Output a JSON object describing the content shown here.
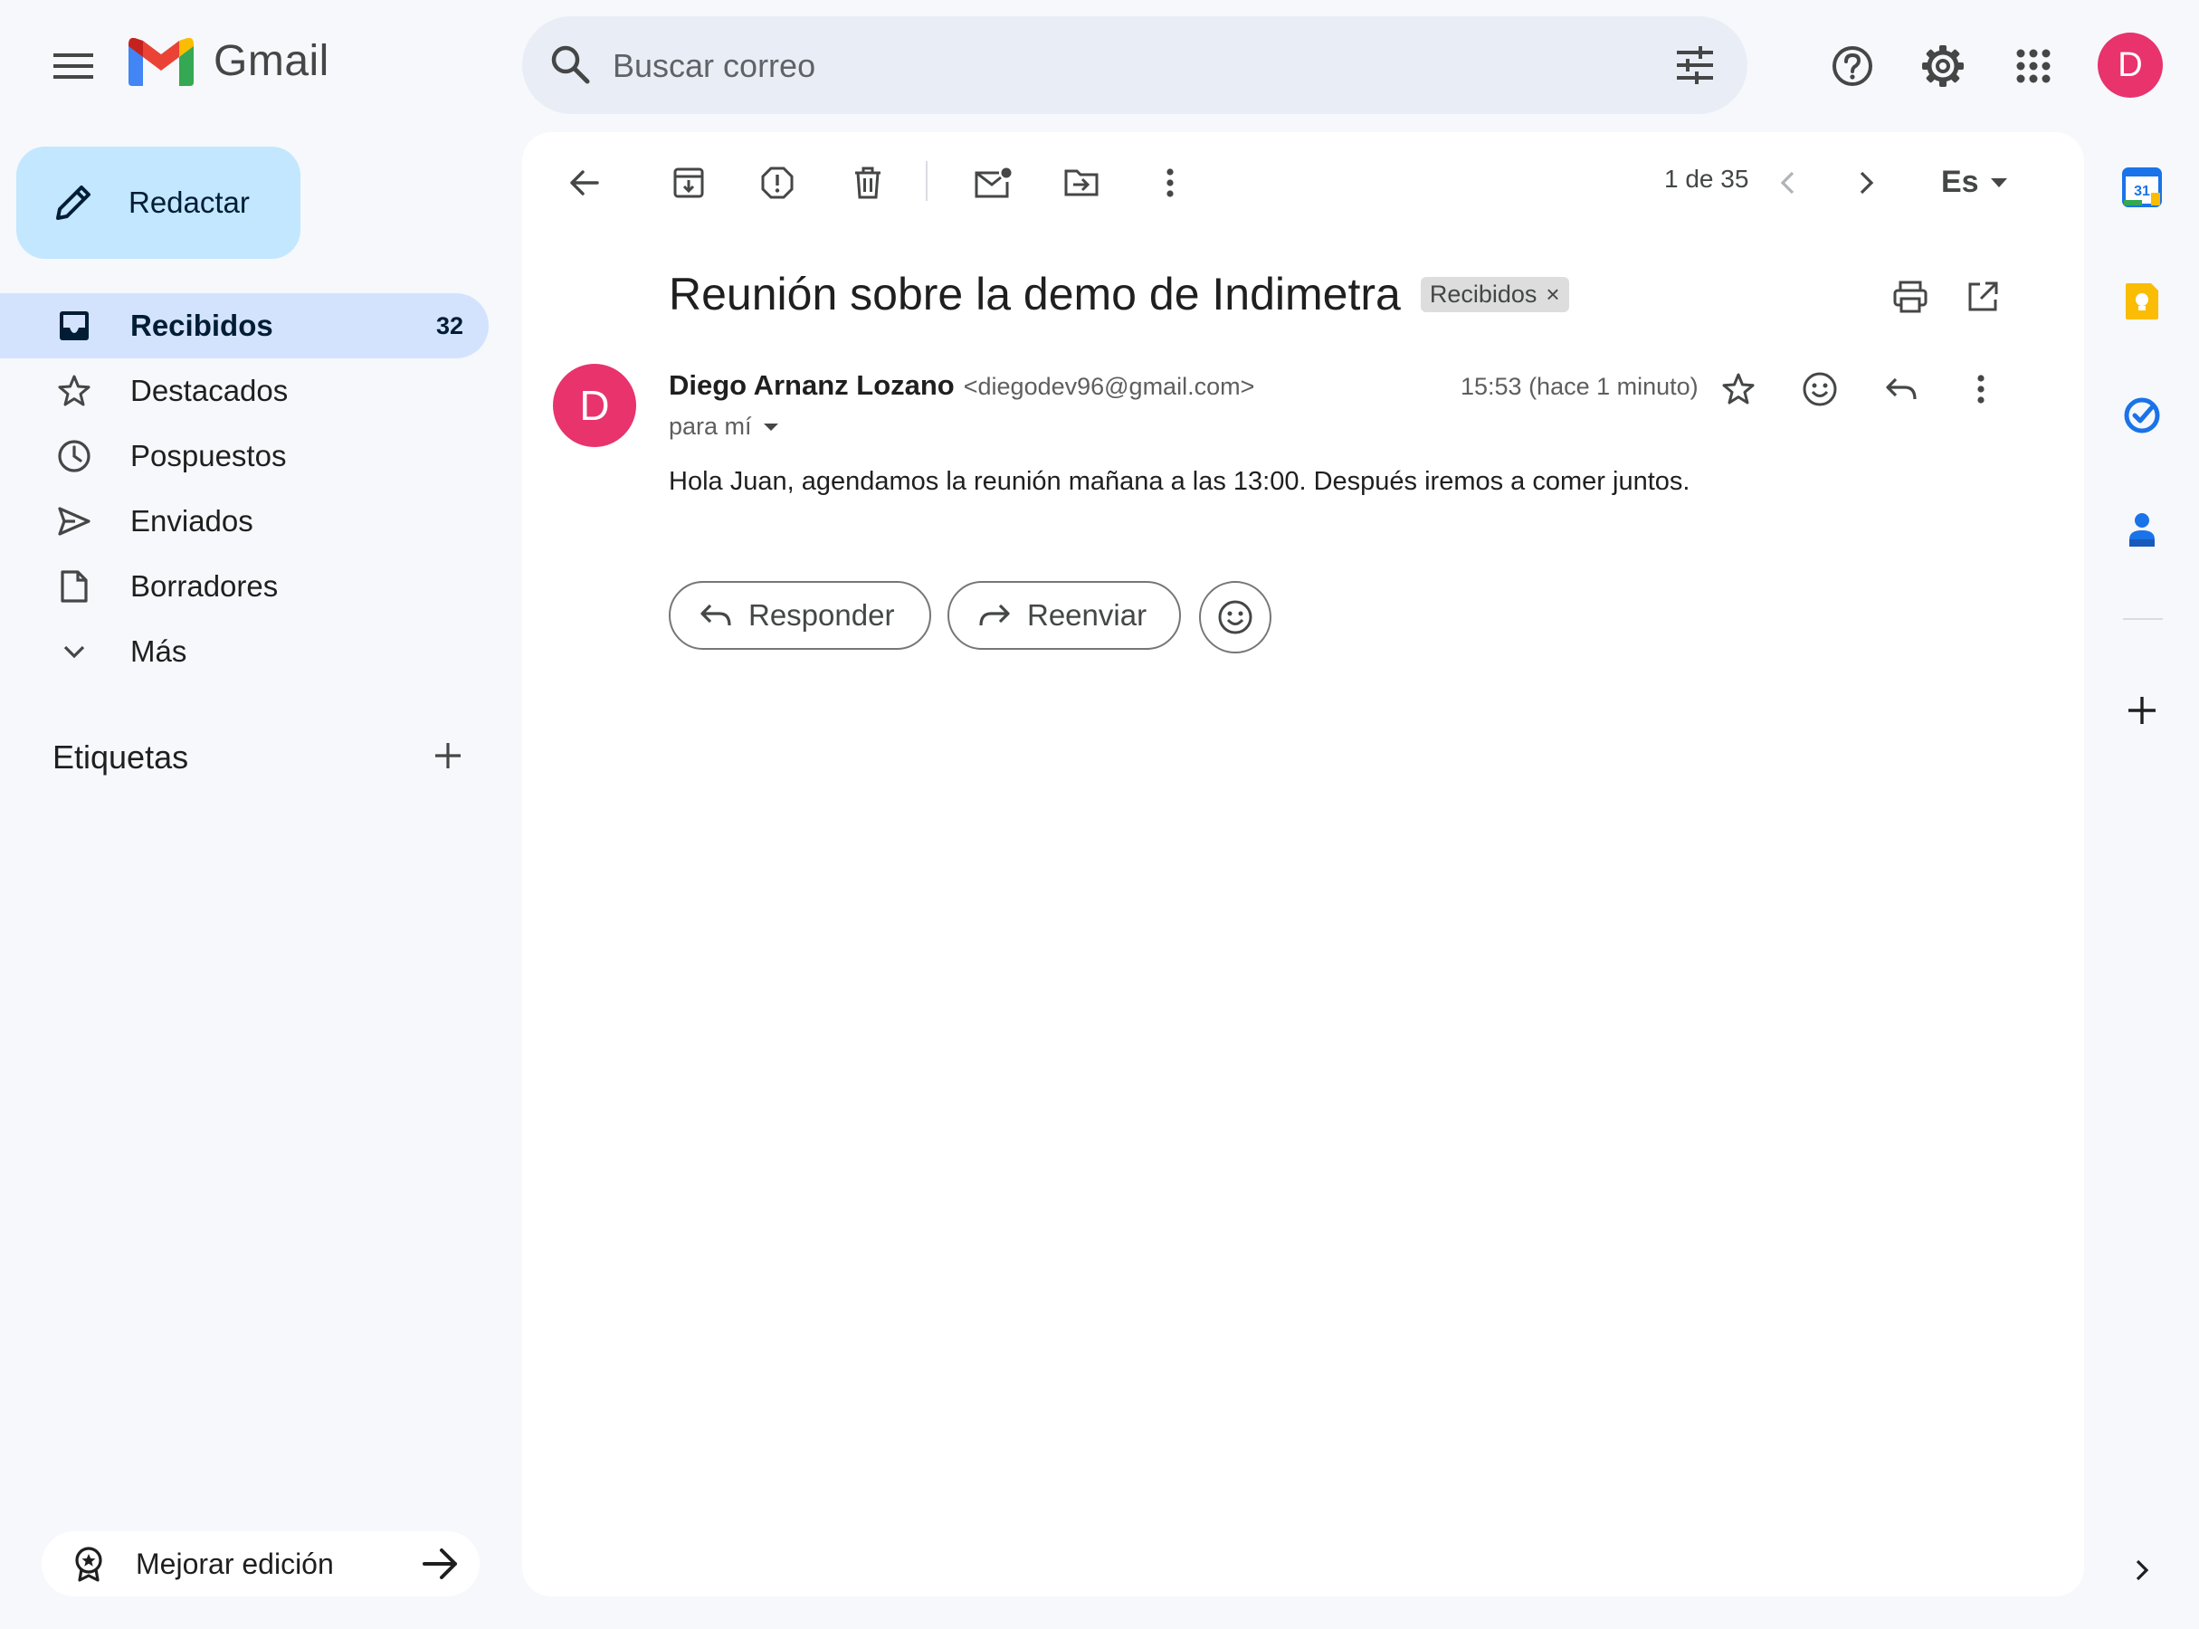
{
  "app": {
    "name": "Gmail"
  },
  "search": {
    "placeholder": "Buscar correo"
  },
  "user": {
    "avatar_letter": "D",
    "avatar_color": "#e8336d"
  },
  "compose": {
    "label": "Redactar"
  },
  "sidebar": {
    "items": [
      {
        "label": "Recibidos",
        "count": "32",
        "icon": "inbox-icon",
        "active": true
      },
      {
        "label": "Destacados",
        "icon": "star-icon"
      },
      {
        "label": "Pospuestos",
        "icon": "clock-icon"
      },
      {
        "label": "Enviados",
        "icon": "send-icon"
      },
      {
        "label": "Borradores",
        "icon": "draft-icon"
      },
      {
        "label": "Más",
        "icon": "chevron-down-icon"
      }
    ],
    "labels_title": "Etiquetas",
    "upgrade_label": "Mejorar edición"
  },
  "toolbar": {
    "pager": "1 de 35",
    "language": "Es"
  },
  "email": {
    "subject": "Reunión sobre la demo de Indimetra",
    "label_chip": "Recibidos",
    "label_chip_close": "×",
    "sender_initial": "D",
    "sender_name": "Diego Arnanz Lozano",
    "sender_email": "<diegodev96@gmail.com>",
    "recipient": "para mí",
    "timestamp": "15:53 (hace 1 minuto)",
    "body": "Hola Juan, agendamos la reunión mañana a las 13:00. Después iremos a comer juntos."
  },
  "actions": {
    "reply_label": "Responder",
    "forward_label": "Reenviar"
  },
  "side_panel": {
    "calendar_day": "31"
  },
  "colors": {
    "background": "#f6f8fc",
    "compose": "#c2e7ff",
    "active_nav": "#d3e3fd",
    "avatar": "#e8336d",
    "calendar_blue": "#1a73e8",
    "keep_yellow": "#fbbc04"
  }
}
